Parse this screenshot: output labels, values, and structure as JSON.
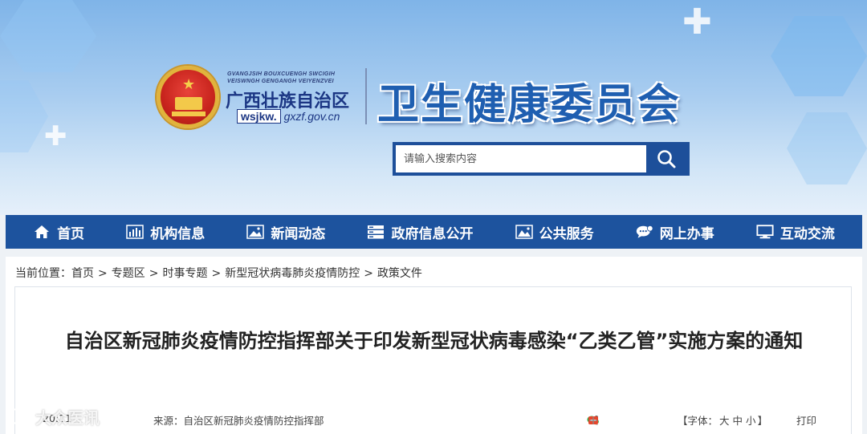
{
  "header": {
    "gov_en_line1": "GVANGJSIH BOUXCUENGH SWCIGIH",
    "gov_en_line2": "VEISWNGH GENGANGH VEIYENZVEI",
    "gov_cn": "广西壮族自治区",
    "url_box": "wsjkw.",
    "url_rest": "gxzf.gov.cn",
    "department": "卫生健康委员会"
  },
  "search": {
    "placeholder": "请输入搜索内容",
    "icon": "search-icon"
  },
  "nav": {
    "items": [
      {
        "label": "首页",
        "icon": "home-icon"
      },
      {
        "label": "机构信息",
        "icon": "bar-chart-icon"
      },
      {
        "label": "新闻动态",
        "icon": "image-icon"
      },
      {
        "label": "政府信息公开",
        "icon": "server-icon"
      },
      {
        "label": "公共服务",
        "icon": "landscape-icon"
      },
      {
        "label": "网上办事",
        "icon": "chat-icon"
      },
      {
        "label": "互动交流",
        "icon": "monitor-icon"
      }
    ]
  },
  "breadcrumb": {
    "prefix": "当前位置：",
    "items": [
      "首页",
      "专题区",
      "时事专题",
      "新型冠状病毒肺炎疫情防控",
      "政策文件"
    ],
    "separator": ">"
  },
  "article": {
    "title": "自治区新冠肺炎疫情防控指挥部关于印发新型冠状病毒感染“乙类乙管”实施方案的通知",
    "date": "20:11",
    "source_label": "来源：",
    "source": "自治区新冠肺炎疫情防控指挥部",
    "share_icons": [
      "share-icon",
      "wechat-icon",
      "weibo-icon",
      "plus-icon"
    ],
    "font_label_open": "【字体：",
    "font_sizes": [
      "大",
      "中",
      "小"
    ],
    "font_label_close": "】",
    "print": "打印"
  },
  "colors": {
    "nav_bg": "#1d539e",
    "title_text": "#1f5fb1",
    "accent": "#1d4f9a"
  }
}
